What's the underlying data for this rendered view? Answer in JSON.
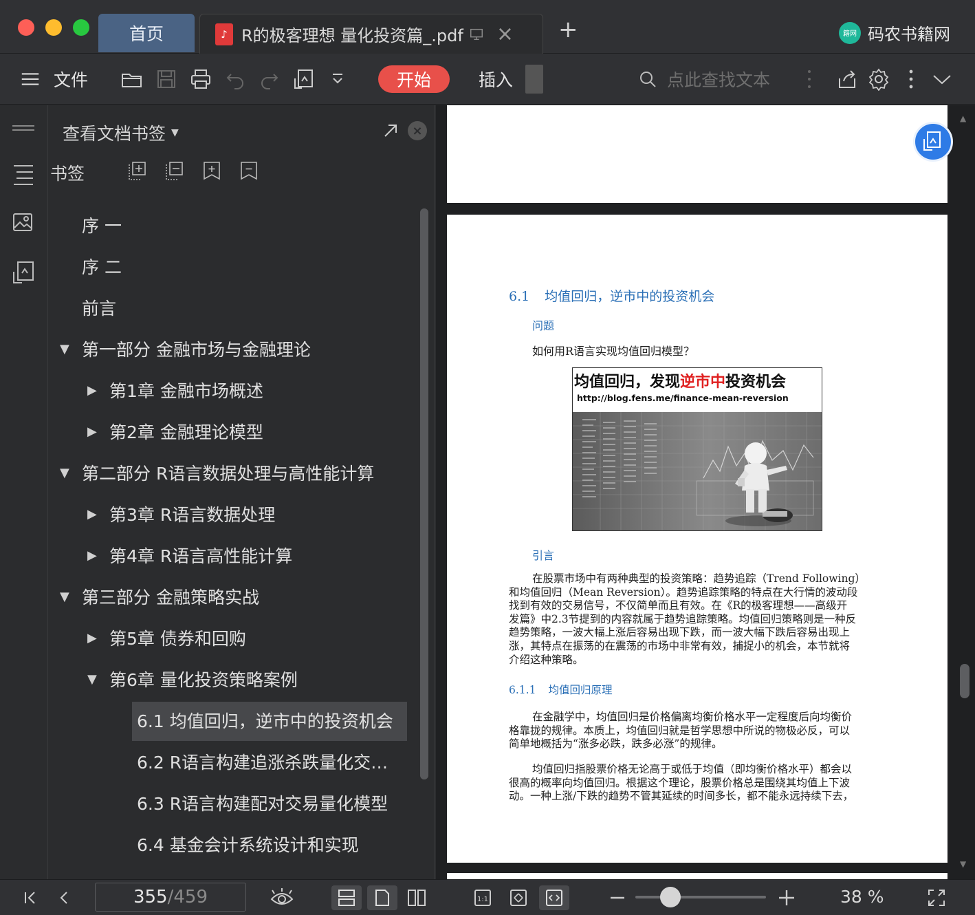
{
  "titlebar": {
    "home_tab": "首页",
    "doc_tab": "R的极客理想 量化投资篇_.pdf",
    "pdf_icon": "pdf-file-icon",
    "brand_logo_text": "籍网",
    "brand_name": "码农书籍网"
  },
  "toolbar": {
    "menu_label": "文件",
    "start": "开始",
    "insert": "插入",
    "search_placeholder": "点此查找文本"
  },
  "bookmark_panel": {
    "title": "查看文档书签",
    "bookmark_label": "书签",
    "items": [
      {
        "label": "序 一",
        "level": 0,
        "arrow": ""
      },
      {
        "label": "序 二",
        "level": 0,
        "arrow": ""
      },
      {
        "label": "前言",
        "level": 0,
        "arrow": ""
      },
      {
        "label": "第一部分 金融市场与金融理论",
        "level": 0,
        "arrow": "▼"
      },
      {
        "label": "第1章 金融市场概述",
        "level": 1,
        "arrow": "▶"
      },
      {
        "label": "第2章 金融理论模型",
        "level": 1,
        "arrow": "▶"
      },
      {
        "label": "第二部分 R语言数据处理与高性能计算",
        "level": 0,
        "arrow": "▼"
      },
      {
        "label": "第3章 R语言数据处理",
        "level": 1,
        "arrow": "▶"
      },
      {
        "label": "第4章 R语言高性能计算",
        "level": 1,
        "arrow": "▶"
      },
      {
        "label": "第三部分 金融策略实战",
        "level": 0,
        "arrow": "▼"
      },
      {
        "label": "第5章 债券和回购",
        "level": 1,
        "arrow": "▶"
      },
      {
        "label": "第6章 量化投资策略案例",
        "level": 1,
        "arrow": "▼"
      },
      {
        "label": "6.1 均值回归，逆市中的投资机会",
        "level": 2,
        "arrow": "",
        "selected": true
      },
      {
        "label": "6.2 R语言构建追涨杀跌量化交…",
        "level": 2,
        "arrow": ""
      },
      {
        "label": "6.3 R语言构建配对交易量化模型",
        "level": 2,
        "arrow": ""
      },
      {
        "label": "6.4 基金会计系统设计和实现",
        "level": 2,
        "arrow": ""
      }
    ]
  },
  "page": {
    "section_num": "6.1",
    "section_title": "均值回归，逆市中的投资机会",
    "problem_heading": "问题",
    "problem_text": "如何用R语言实现均值回归模型？",
    "figure_title_a": "均值回归，发现",
    "figure_title_red": "逆市中",
    "figure_title_b": "投资机会",
    "figure_url": "http://blog.fens.me/finance-mean-reversion",
    "intro_heading": "引言",
    "intro_lines": [
      "在股票市场中有两种典型的投资策略：趋势追踪（Trend Following）",
      "和均值回归（Mean Reversion）。趋势追踪策略的特点在大行情的波动段",
      "找到有效的交易信号，不仅简单而且有效。在《R的极客理想——高级开",
      "发篇》中2.3节提到的内容就属于趋势追踪策略。均值回归策略则是一种反",
      "趋势策略，一波大幅上涨后容易出现下跌，而一波大幅下跌后容易出现上",
      "涨，其特点在振荡的在震荡的市场中非常有效，捕捉小的机会，本节就将",
      "介绍这种策略。"
    ],
    "sub_num": "6.1.1",
    "sub_title": "均值回归原理",
    "p1_lines": [
      "在金融学中，均值回归是价格偏离均衡价格水平一定程度后向均衡价",
      "格靠拢的规律。本质上，均值回归就是哲学思想中所说的物极必反，可以",
      "简单地概括为“涨多必跌，跌多必涨”的规律。"
    ],
    "p2_lines": [
      "均值回归指股票价格无论高于或低于均值（即均衡价格水平）都会以",
      "很高的概率向均值回归。根据这个理论，股票价格总是围绕其均值上下波",
      "动。一种上涨/下跌的趋势不管其延续的时间多长，都不能永远持续下去，"
    ]
  },
  "statusbar": {
    "current_page": "355",
    "separator": "/",
    "total_pages": "459",
    "zoom": "38 %",
    "zoom_fraction": 0.27
  }
}
